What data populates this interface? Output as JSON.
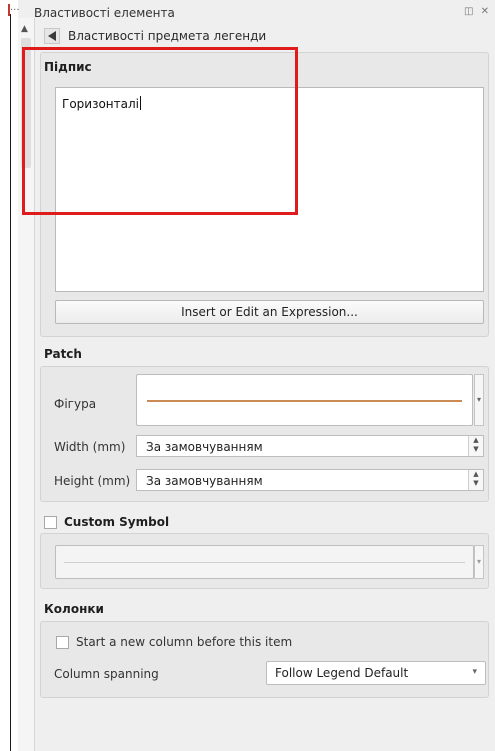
{
  "window": {
    "title": "Властивості елемента",
    "window_buttons": "◫ ✕"
  },
  "breadcrumb": {
    "label": "Властивості предмета легенди"
  },
  "caption": {
    "section_title": "Підпис",
    "text_value": "Горизонталі",
    "expression_button": "Insert or Edit an Expression..."
  },
  "patch": {
    "section_title": "Patch",
    "figure_label": "Фігура",
    "width_label": "Width (mm)",
    "width_value": "За замовчуванням",
    "height_label": "Height (mm)",
    "height_value": "За замовчуванням",
    "line_color": "#c98a55"
  },
  "custom_symbol": {
    "label": "Custom Symbol",
    "checked": false
  },
  "columns": {
    "section_title": "Колонки",
    "new_column_label": "Start a new column before this item",
    "new_column_checked": false,
    "spanning_label": "Column spanning",
    "spanning_value": "Follow Legend Default"
  },
  "highlight_color": "#e01b1b"
}
